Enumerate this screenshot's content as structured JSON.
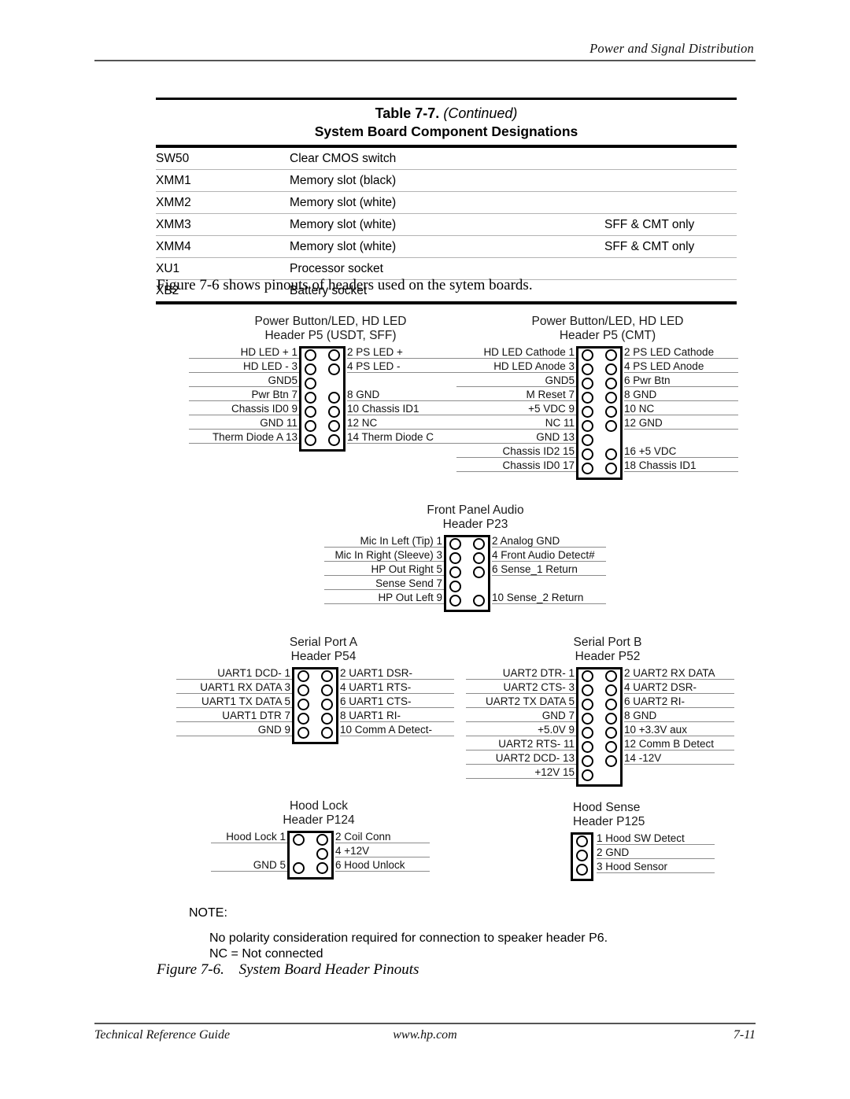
{
  "page": {
    "running_header": "Power and Signal Distribution",
    "intro_sentence": "Figure 7-6 shows pinouts of headers used on the sytem boards.",
    "footer_left": "Technical Reference Guide",
    "footer_center": "www.hp.com",
    "footer_page": "7-11"
  },
  "table": {
    "title_main": "Table 7-7.",
    "title_continued": "(Continued)",
    "subtitle": "System Board Component Designations",
    "rows": [
      {
        "designator": "SW50",
        "description": "Clear CMOS switch",
        "note": ""
      },
      {
        "designator": "XMM1",
        "description": "Memory slot (black)",
        "note": ""
      },
      {
        "designator": "XMM2",
        "description": "Memory slot (white)",
        "note": ""
      },
      {
        "designator": "XMM3",
        "description": "Memory slot (white)",
        "note": "SFF & CMT only"
      },
      {
        "designator": "XMM4",
        "description": "Memory slot (white)",
        "note": "SFF & CMT only"
      },
      {
        "designator": "XU1",
        "description": "Processor socket",
        "note": ""
      },
      {
        "designator": "XB2",
        "description": "Battery socket",
        "note": ""
      }
    ]
  },
  "headers": [
    {
      "id": "p5-usdt-sff",
      "title_line1": "Power Button/LED, HD LED",
      "title_line2": "Header P5 (USDT, SFF)",
      "rows": [
        {
          "left": "HD LED + 1",
          "right": "2 PS LED +",
          "left_pin": true,
          "right_pin": true
        },
        {
          "left": "HD LED - 3",
          "right": "4 PS LED -",
          "left_pin": true,
          "right_pin": true
        },
        {
          "left": "GND5",
          "right": "",
          "left_pin": true,
          "right_pin": false
        },
        {
          "left": "Pwr Btn 7",
          "right": "8 GND",
          "left_pin": true,
          "right_pin": true
        },
        {
          "left": "Chassis ID0 9",
          "right": "10 Chassis ID1",
          "left_pin": true,
          "right_pin": true
        },
        {
          "left": "GND 11",
          "right": "12 NC",
          "left_pin": true,
          "right_pin": true
        },
        {
          "left": "Therm Diode A 13",
          "right": "14 Therm Diode C",
          "left_pin": true,
          "right_pin": true
        }
      ]
    },
    {
      "id": "p5-cmt",
      "title_line1": "Power Button/LED, HD LED",
      "title_line2": "Header P5 (CMT)",
      "rows": [
        {
          "left": "HD LED Cathode 1",
          "right": "2 PS LED Cathode",
          "left_pin": true,
          "right_pin": true
        },
        {
          "left": "HD LED Anode 3",
          "right": "4 PS LED Anode",
          "left_pin": true,
          "right_pin": true
        },
        {
          "left": "GND5",
          "right": "6 Pwr Btn",
          "left_pin": true,
          "right_pin": true
        },
        {
          "left": "M Reset 7",
          "right": "8 GND",
          "left_pin": true,
          "right_pin": true
        },
        {
          "left": "+5 VDC 9",
          "right": "10 NC",
          "left_pin": true,
          "right_pin": true
        },
        {
          "left": "NC 11",
          "right": "12 GND",
          "left_pin": true,
          "right_pin": true
        },
        {
          "left": "GND 13",
          "right": "",
          "left_pin": true,
          "right_pin": false
        },
        {
          "left": "Chassis ID2 15",
          "right": "16 +5 VDC",
          "left_pin": true,
          "right_pin": true
        },
        {
          "left": "Chassis ID0 17",
          "right": "18 Chassis ID1",
          "left_pin": true,
          "right_pin": true
        }
      ]
    },
    {
      "id": "p23-front-panel-audio",
      "title_line1": "Front Panel Audio",
      "title_line2": "Header P23",
      "rows": [
        {
          "left": "Mic In Left (Tip) 1",
          "right": "2 Analog GND",
          "left_pin": true,
          "right_pin": true
        },
        {
          "left": "Mic In Right (Sleeve) 3",
          "right": "4 Front Audio Detect#",
          "left_pin": true,
          "right_pin": true
        },
        {
          "left": "HP Out Right 5",
          "right": "6 Sense_1 Return",
          "left_pin": true,
          "right_pin": true
        },
        {
          "left": "Sense Send 7",
          "right": "",
          "left_pin": true,
          "right_pin": false
        },
        {
          "left": "HP Out Left 9",
          "right": "10 Sense_2 Return",
          "left_pin": true,
          "right_pin": true
        }
      ]
    },
    {
      "id": "p54-serial-port-a",
      "title_line1": "Serial Port A",
      "title_line2": "Header P54",
      "rows": [
        {
          "left": "UART1 DCD- 1",
          "right": "2 UART1 DSR-",
          "left_pin": true,
          "right_pin": true
        },
        {
          "left": "UART1 RX DATA 3",
          "right": "4 UART1 RTS-",
          "left_pin": true,
          "right_pin": true
        },
        {
          "left": "UART1 TX DATA 5",
          "right": "6 UART1 CTS-",
          "left_pin": true,
          "right_pin": true
        },
        {
          "left": "UART1 DTR 7",
          "right": "8 UART1 RI-",
          "left_pin": true,
          "right_pin": true
        },
        {
          "left": "GND 9",
          "right": "10 Comm A Detect-",
          "left_pin": true,
          "right_pin": true
        }
      ]
    },
    {
      "id": "p52-serial-port-b",
      "title_line1": "Serial Port B",
      "title_line2": "Header P52",
      "rows": [
        {
          "left": "UART2 DTR- 1",
          "right": "2 UART2 RX DATA",
          "left_pin": true,
          "right_pin": true
        },
        {
          "left": "UART2 CTS- 3",
          "right": "4 UART2 DSR-",
          "left_pin": true,
          "right_pin": true
        },
        {
          "left": "UART2 TX DATA 5",
          "right": "6 UART2 RI-",
          "left_pin": true,
          "right_pin": true
        },
        {
          "left": "GND 7",
          "right": "8 GND",
          "left_pin": true,
          "right_pin": true
        },
        {
          "left": "+5.0V 9",
          "right": "10 +3.3V aux",
          "left_pin": true,
          "right_pin": true
        },
        {
          "left": "UART2 RTS- 11",
          "right": "12 Comm B Detect",
          "left_pin": true,
          "right_pin": true
        },
        {
          "left": "UART2 DCD- 13",
          "right": "14 -12V",
          "left_pin": true,
          "right_pin": true
        },
        {
          "left": "+12V 15",
          "right": "",
          "left_pin": true,
          "right_pin": false
        }
      ]
    },
    {
      "id": "p124-hood-lock",
      "title_line1": "Hood Lock",
      "title_line2": "Header P124",
      "rows": [
        {
          "left": "Hood Lock 1",
          "right": "2 Coil Conn",
          "left_pin": true,
          "right_pin": true
        },
        {
          "left": "",
          "right": "4 +12V",
          "left_pin": false,
          "right_pin": true
        },
        {
          "left": "GND 5",
          "right": "6 Hood Unlock",
          "left_pin": true,
          "right_pin": true
        }
      ]
    },
    {
      "id": "p125-hood-sense",
      "title_line1": "Hood Sense",
      "title_line2": "Header P125",
      "single_column": true,
      "rows": [
        {
          "left": "",
          "right": "1 Hood SW Detect",
          "left_pin": true,
          "right_pin": false
        },
        {
          "left": "",
          "right": "2 GND",
          "left_pin": true,
          "right_pin": false
        },
        {
          "left": "",
          "right": "3 Hood Sensor",
          "left_pin": true,
          "right_pin": false
        }
      ]
    }
  ],
  "note": {
    "heading": "NOTE:",
    "line1": "No polarity consideration required for connection to speaker header P6.",
    "line2": "NC = Not connected"
  },
  "figure_caption": {
    "label": "Figure 7-6.",
    "text": "System Board Header Pinouts"
  }
}
